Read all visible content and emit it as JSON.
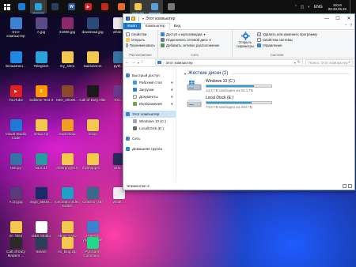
{
  "taskbar": {
    "apps": [
      {
        "name": "vscode",
        "glyph": "",
        "color": "#1e7ad6",
        "active": false
      },
      {
        "name": "telegram",
        "glyph": "",
        "color": "#2aa3dd",
        "active": true
      },
      {
        "name": "steam",
        "glyph": "",
        "color": "#2a3f5a",
        "active": false
      },
      {
        "name": "word",
        "glyph": "W",
        "color": "#2b5797",
        "active": false
      },
      {
        "name": "youtube",
        "glyph": "▶",
        "color": "#e02020",
        "active": false
      },
      {
        "name": "app-red",
        "glyph": "",
        "color": "#c0281e",
        "active": false
      },
      {
        "name": "firefox",
        "glyph": "",
        "color": "#e8672a",
        "active": false
      },
      {
        "name": "explorer",
        "glyph": "",
        "color": "#f2c94c",
        "active": true
      },
      {
        "name": "gallery",
        "glyph": "",
        "color": "#5aa0d8",
        "active": true
      },
      {
        "name": "app-gray",
        "glyph": "",
        "color": "#777777",
        "active": false
      }
    ],
    "tray": {
      "lang": "ENG",
      "time": "19:44",
      "date": "08.28.05.22"
    }
  },
  "desktop": {
    "icons": [
      {
        "id": "this-pc",
        "label": "Этот компьютер",
        "color": "#3b82d0",
        "glyph": ""
      },
      {
        "id": "a-jpg",
        "label": "A.jpg",
        "color": "#5a4a8a",
        "glyph": ""
      },
      {
        "id": "21906-jpg",
        "label": "21906.jpg",
        "color": "#8a2a6a",
        "glyph": ""
      },
      {
        "id": "download-jpg",
        "label": "download.jpg",
        "color": "#2a4a7a",
        "glyph": ""
      },
      {
        "id": "white",
        "label": "white...",
        "color": "#e8e8e8",
        "glyph": ""
      },
      {
        "id": "untitled",
        "label": "Безымянн...",
        "color": "#1e88e5",
        "glyph": ""
      },
      {
        "id": "telegram",
        "label": "Telegram",
        "color": "#2aa3dd",
        "glyph": ""
      },
      {
        "id": "my-site1",
        "label": "my_site1",
        "color": "#f2c94c",
        "glyph": ""
      },
      {
        "id": "saidusmon",
        "label": "Saidusmon",
        "color": "#f2c94c",
        "glyph": ""
      },
      {
        "id": "pyth",
        "label": "pyth...",
        "color": "#3572a5",
        "glyph": ""
      },
      {
        "id": "youtube",
        "label": "YouTube",
        "color": "#e02020",
        "glyph": "▶"
      },
      {
        "id": "sublime",
        "label": "Sublime Text 3",
        "color": "#ff9800",
        "glyph": "S"
      },
      {
        "id": "img2019",
        "label": "IMG_20190...",
        "color": "#8a4a2a",
        "glyph": ""
      },
      {
        "id": "cod-elite",
        "label": "Call of Duty elite",
        "color": "#1a1a1a",
        "glyph": ""
      },
      {
        "id": "kro",
        "label": "Kro...",
        "color": "#6a3a8a",
        "glyph": ""
      },
      {
        "id": "vscode",
        "label": "Visual Studio Code",
        "color": "#1e7ad6",
        "glyph": ""
      },
      {
        "id": "setup-zip",
        "label": "setup.zip",
        "color": "#f2c94c",
        "glyph": ""
      },
      {
        "id": "gameloop",
        "label": "Gameloop",
        "color": "#f0a020",
        "glyph": ""
      },
      {
        "id": "shop",
        "label": "shop",
        "color": "#f2c94c",
        "glyph": ""
      },
      {
        "id": "testpy",
        "label": "test.py",
        "color": "#3572a5",
        "glyph": ""
      },
      {
        "id": "olx",
        "label": "OLX.uz",
        "color": "#2a9aa0",
        "glyph": ""
      },
      {
        "id": "enterproject",
        "label": "enterprojectS",
        "color": "#f2c94c",
        "glyph": ""
      },
      {
        "id": "myshop",
        "label": "myshoppro...",
        "color": "#f2c94c",
        "glyph": ""
      },
      {
        "id": "a2jpg",
        "label": "A (2).jpg",
        "color": "#5a3a7a",
        "glyph": ""
      },
      {
        "id": "img0",
        "label": "img0_3840x...",
        "color": "#1a2a6a",
        "glyph": ""
      },
      {
        "id": "icecream",
        "label": "Icecream Video Editor",
        "color": "#1fa0c8",
        "glyph": ""
      },
      {
        "id": "cinemo",
        "label": "CinEmo (46)",
        "color": "#3a6a8a",
        "glyph": ""
      },
      {
        "id": "virtual",
        "label": "virtu...",
        "color": "#2a2a5a",
        "glyph": ""
      },
      {
        "id": "ec-blog",
        "label": "ec_blog",
        "color": "#f2c94c",
        "glyph": ""
      },
      {
        "id": "dbs",
        "label": "DBS Studio",
        "color": "#ffffff",
        "glyph": ""
      },
      {
        "id": "ekran",
        "label": "ekran SAID",
        "color": "#f2c94c",
        "glyph": ""
      },
      {
        "id": "panel",
        "label": "Панель управления",
        "color": "#3b82d0",
        "glyph": ""
      },
      {
        "id": "whitelabel",
        "label": "white...",
        "color": "#f0f0f0",
        "glyph": ""
      },
      {
        "id": "cod-mw",
        "label": "Call of Duty Modern ...",
        "color": "#2a2a2a",
        "glyph": ""
      },
      {
        "id": "steam",
        "label": "Steam",
        "color": "#2a3f5a",
        "glyph": ""
      },
      {
        "id": "ec-blog-zip",
        "label": "ec_blog.zip",
        "color": "#f2c94c",
        "glyph": ""
      },
      {
        "id": "pycharm",
        "label": "PyCharm Communi...",
        "color": "#21d789",
        "glyph": ""
      }
    ]
  },
  "explorer": {
    "title": "Этот компьютер",
    "ribbon_tabs": [
      "Файл",
      "Компьютер",
      "Вид"
    ],
    "groups": {
      "location": {
        "label": "Расположение",
        "items": [
          "Свойства",
          "Открыть",
          "Переименовать"
        ]
      },
      "network": {
        "label": "Сеть",
        "items": [
          "Доступ к мультимедиа",
          "Подключить сетевой диск",
          "Добавить сетевое расположение"
        ]
      },
      "system": {
        "label": "Система",
        "big": "Открыть параметры",
        "items": [
          "Удалить или изменить программу",
          "Свойства системы",
          "Управление"
        ]
      }
    },
    "address": "Этот компьютер",
    "search_placeholder": "Поиск: Этот компьютер",
    "nav": {
      "quick_access": "Быстрый доступ",
      "pinned": [
        "Рабочий стол",
        "Загрузки",
        "Документы",
        "Изображения"
      ],
      "this_pc": "Этот компьютер",
      "drives": [
        "Windows 10 (C:)",
        "Locall Dick (E:)"
      ],
      "network": "Сеть",
      "homegroup": "Домашняя группа"
    },
    "section_title": "Жесткие диски (2)",
    "drives": [
      {
        "name": "Windows 10 (C:)",
        "free": "14,5 ГБ свободно из 53,1 ГБ",
        "used_fraction": 0.73
      },
      {
        "name": "Local Disck (E:)",
        "free": "74,5 ГБ свободно из 244 ГБ",
        "used_fraction": 0.69
      }
    ],
    "status": "Элементов: 2"
  }
}
